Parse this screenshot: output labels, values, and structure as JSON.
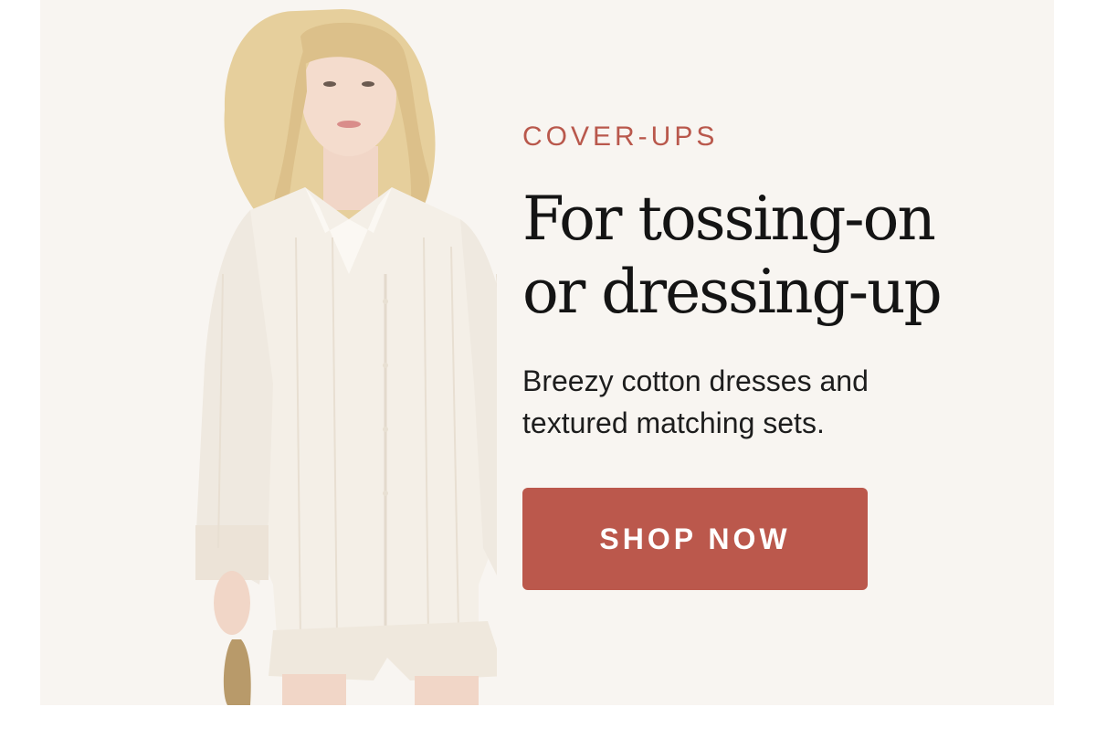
{
  "banner": {
    "eyebrow": "COVER-UPS",
    "headline_line1": "For tossing-on",
    "headline_line2": "or dressing-up",
    "subhead_line1": "Breezy cotton dresses and",
    "subhead_line2": "textured matching sets.",
    "cta_label": "SHOP NOW"
  },
  "colors": {
    "background": "#f8f5f1",
    "accent": "#bb584c",
    "headline": "#141414"
  },
  "image": {
    "subject": "model-in-white-cotton-shirt-and-shorts-icon"
  }
}
